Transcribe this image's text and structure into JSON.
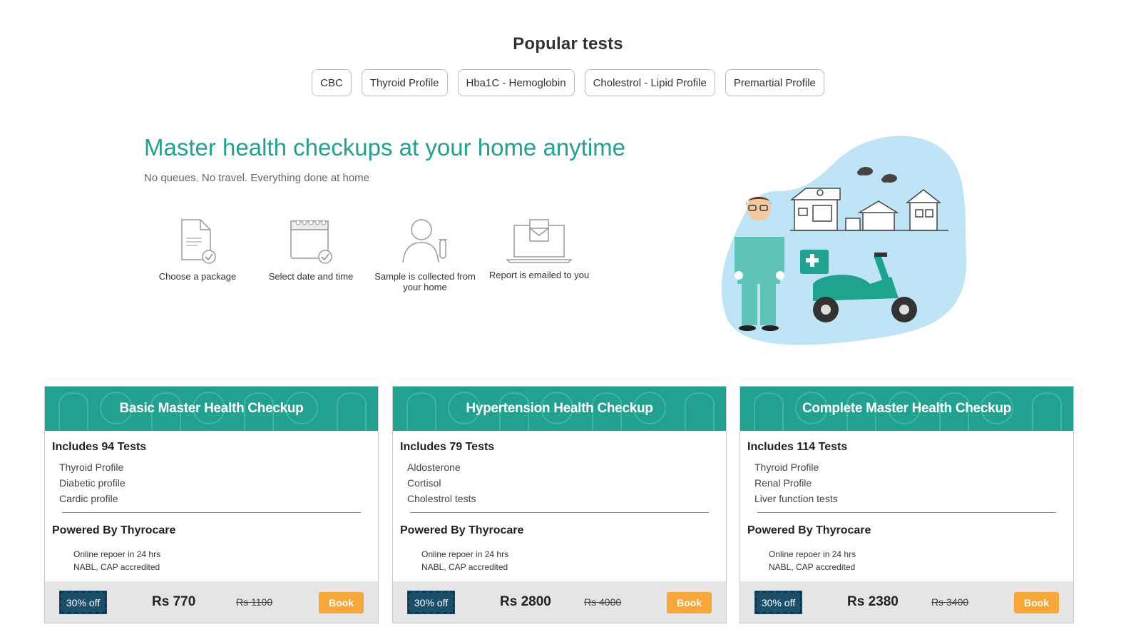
{
  "popular": {
    "title": "Popular tests",
    "tests": [
      "CBC",
      "Thyroid Profile",
      "Hba1C - Hemoglobin",
      "Cholestrol - Lipid Profile",
      "Premartial Profile"
    ]
  },
  "hero": {
    "title": "Master health checkups at your home anytime",
    "subtitle": "No queues. No travel. Everything done at home",
    "steps": [
      {
        "icon": "document-check-icon",
        "line1": "Choose a package",
        "line2": ""
      },
      {
        "icon": "calendar-check-icon",
        "line1": "Select date and time",
        "line2": ""
      },
      {
        "icon": "person-sample-icon",
        "line1": "Sample is collected from",
        "line2": "your home"
      },
      {
        "icon": "laptop-email-icon",
        "line1": "Report is emailed to you",
        "line2": ""
      }
    ]
  },
  "colors": {
    "accent": "#22a191",
    "badge": "#1c4f6a",
    "book": "#f7a73a",
    "blob": "#bfe4f5"
  },
  "cards": [
    {
      "title": "Basic Master Health Checkup",
      "includes": "Includes 94 Tests",
      "tests": [
        "Thyroid Profile",
        "Diabetic profile",
        "Cardic profile"
      ],
      "powered": "Powered By Thyrocare",
      "features": [
        "Online repoer in 24 hrs",
        "NABL, CAP accredited"
      ],
      "discount": "30% off",
      "price": "Rs 770",
      "old_price": "Rs 1100",
      "book": "Book"
    },
    {
      "title": "Hypertension Health Checkup",
      "includes": "Includes 79 Tests",
      "tests": [
        "Aldosterone",
        "Cortisol",
        "Cholestrol tests"
      ],
      "powered": "Powered By Thyrocare",
      "features": [
        "Online repoer in 24 hrs",
        "NABL, CAP accredited"
      ],
      "discount": "30% off",
      "price": "Rs 2800",
      "old_price": "Rs 4000",
      "book": "Book"
    },
    {
      "title": "Complete Master Health Checkup",
      "includes": "Includes 114 Tests",
      "tests": [
        "Thyroid Profile",
        "Renal Profile",
        "Liver function tests"
      ],
      "powered": "Powered By Thyrocare",
      "features": [
        "Online repoer in 24 hrs",
        "NABL, CAP accredited"
      ],
      "discount": "30% off",
      "price": "Rs 2380",
      "old_price": "Rs 3400",
      "book": "Book"
    }
  ]
}
